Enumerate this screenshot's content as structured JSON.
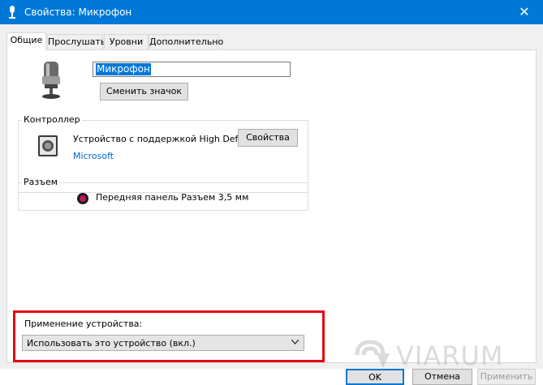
{
  "window": {
    "title": "Свойства: Микрофон",
    "close_glyph": "✕"
  },
  "tabs": [
    {
      "label": "Общие"
    },
    {
      "label": "Прослушать"
    },
    {
      "label": "Уровни"
    },
    {
      "label": "Дополнительно"
    }
  ],
  "device": {
    "name": "Микрофон",
    "change_icon_label": "Сменить значок"
  },
  "controller": {
    "title": "Контроллер",
    "name": "Устройство с поддержкой High Defi...",
    "properties_label": "Свойства",
    "vendor": "Microsoft"
  },
  "jack": {
    "title": "Разъем",
    "description": "Передняя панель Разъем 3,5 мм"
  },
  "usage": {
    "label": "Применение устройства:",
    "value": "Использовать это устройство (вкл.)"
  },
  "buttons": {
    "ok": "OK",
    "cancel": "Отмена",
    "apply": "Применить"
  },
  "watermark": {
    "text": "VIARUM"
  },
  "colors": {
    "titlebar": "#0078d7",
    "highlight": "#e30613",
    "link": "#0066cc",
    "jack_dot": "#c0185c"
  }
}
